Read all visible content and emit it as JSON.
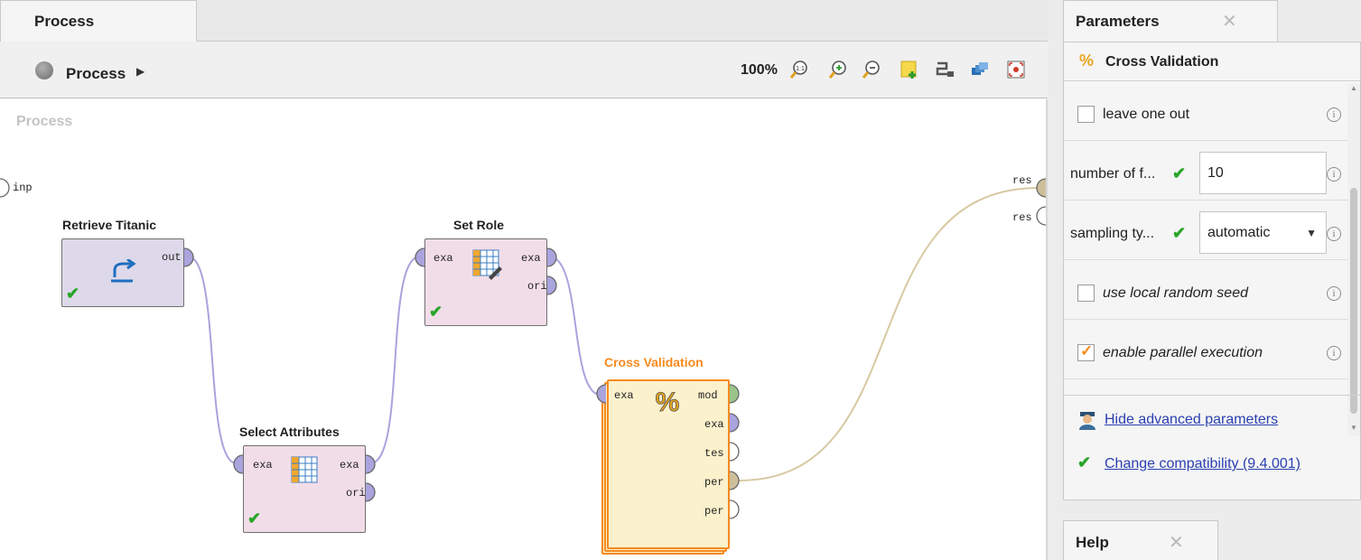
{
  "process_panel": {
    "tab_label": "Process",
    "breadcrumb": "Process",
    "zoom": "100%",
    "canvas_title": "Process",
    "process_input_port": "inp",
    "process_output_ports": [
      "res",
      "res"
    ],
    "operators": {
      "retrieve": {
        "title": "Retrieve Titanic",
        "ports_out": [
          "out"
        ]
      },
      "select_attributes": {
        "title": "Select Attributes",
        "ports_in": [
          "exa"
        ],
        "ports_out": [
          "exa",
          "ori"
        ]
      },
      "set_role": {
        "title": "Set Role",
        "ports_in": [
          "exa"
        ],
        "ports_out": [
          "exa",
          "ori"
        ]
      },
      "cross_validation": {
        "title": "Cross Validation",
        "ports_in": [
          "exa"
        ],
        "ports_out": [
          "mod",
          "exa",
          "tes",
          "per",
          "per"
        ]
      }
    }
  },
  "parameters_panel": {
    "tab_label": "Parameters",
    "operator_name": "Cross Validation",
    "params": {
      "leave_one_out": {
        "label": "leave one out",
        "checked": false
      },
      "number_of_folds": {
        "label": "number of f...",
        "value": "10"
      },
      "sampling_type": {
        "label": "sampling ty...",
        "value": "automatic"
      },
      "use_local_random_seed": {
        "label": "use local random seed",
        "checked": false
      },
      "enable_parallel_execution": {
        "label": "enable parallel execution",
        "checked": true
      }
    },
    "links": {
      "hide_advanced": "Hide advanced parameters",
      "change_compatibility": "Change compatibility (9.4.001)"
    }
  },
  "help_panel": {
    "tab_label": "Help"
  },
  "colors": {
    "accent_orange": "#f68a1e",
    "connection_purple": "#a9a4dd",
    "connection_tan": "#d7c9a2",
    "check_green": "#28a528",
    "link_blue": "#2a3fb0"
  }
}
